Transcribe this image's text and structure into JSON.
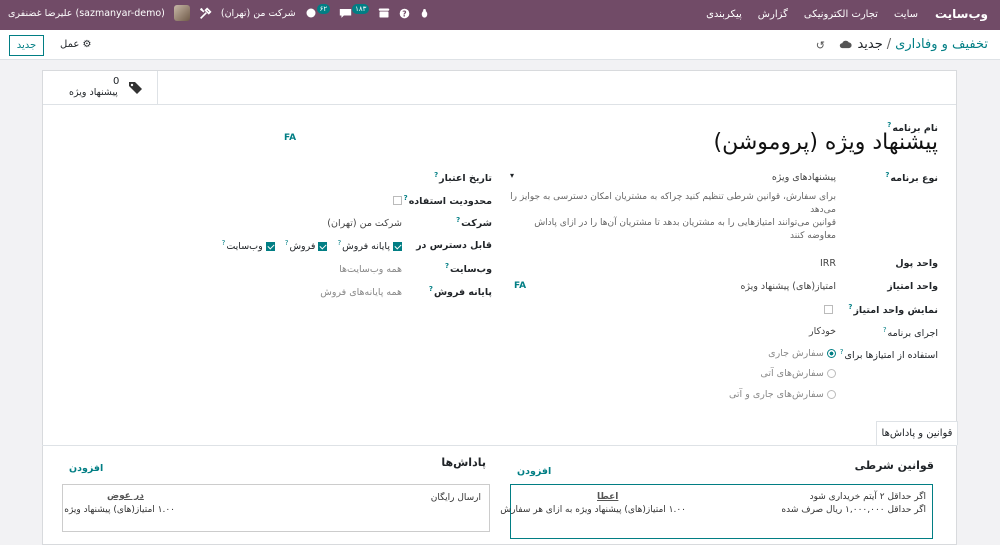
{
  "navbar": {
    "app_name": "وب‌سایت",
    "menu": [
      "سایت",
      "تجارت الکترونیکی",
      "گزارش",
      "پیکربندی"
    ],
    "user_label": "علیرضا غضنفری (sazmanyar-demo)",
    "company": "شرکت من (تهران)",
    "messages_count": "۱۸۳",
    "activity_count": "۶۲"
  },
  "control_panel": {
    "new_button": "جدید",
    "action_label": "عمل",
    "breadcrumb_parent": "تخفیف و وفاداری",
    "breadcrumb_current": "جدید"
  },
  "stat_button": {
    "count": "0",
    "label": "پیشنهاد ویژه"
  },
  "form": {
    "name_label": "نام برنامه",
    "name_value": "پیشنهاد ویژه (پروموشن)",
    "lang_badge": "FA",
    "program_type_label": "نوع برنامه",
    "program_type_value": "پیشنهادهای ویژه",
    "program_type_desc_1": "برای سفارش، قوانین شرطی تنظیم کنید چراکه به مشتریان امکان دسترسی به جوایز را می‌دهد",
    "program_type_desc_2": "قوانین می‌توانند امتیازهایی را به مشتریان بدهد تا مشتریان آن‌ها را در ازای پاداش معاوضه کنند",
    "currency_label": "واحد پول",
    "currency_value": "IRR",
    "point_unit_label": "واحد امتیاز",
    "point_unit_value": "امتیاز(های) پیشنهاد ویژه",
    "point_unit_badge": "FA",
    "show_points_label": "نمایش واحد امتیاز",
    "trigger_label": "اجرای برنامه",
    "trigger_value": "خودکار",
    "apply_on_label": "استفاده از امتیازها برای",
    "apply_options": [
      "سفارش جاری",
      "سفارش‌های آتی",
      "سفارش‌های جاری و آتی"
    ],
    "validity_label": "تاریخ اعتبار",
    "limit_label": "محدودیت استفاده",
    "company_label": "شرکت",
    "company_value": "شرکت من (تهران)",
    "available_on_label": "قابل دسترس در",
    "available_on": [
      "فروش",
      "پایانه فروش",
      "وب‌سایت"
    ],
    "website_label": "وب‌سایت",
    "website_value": "همه وب‌سایت‌ها",
    "pos_label": "پایانه فروش",
    "pos_value": "همه پایانه‌های فروش"
  },
  "tabs": {
    "rules_rewards": "قوانین و پاداش‌ها"
  },
  "rules": {
    "title": "قوانین شرطی",
    "add_label": "افزودن",
    "line1": "اگر حداقل ۲ آیتم خریداری شود",
    "line2": "اگر حداقل ۱,۰۰۰,۰۰۰ ریال صرف شده",
    "grant_label": "اعطا",
    "grant_value": "۱.۰۰ امتیاز(های) پیشنهاد ویژه به ازای هر سفارش"
  },
  "rewards": {
    "title": "پاداش‌ها",
    "add_label": "افزودن",
    "reward_name": "ارسال رایگان",
    "in_exchange_label": "در عوض",
    "in_exchange_value": "۱.۰۰ امتیاز(های) پیشنهاد ویژه"
  },
  "colors": {
    "navbar": "#714b67",
    "accent": "#017e84"
  }
}
